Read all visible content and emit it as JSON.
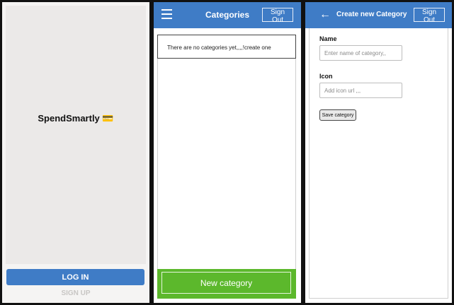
{
  "login": {
    "brand": "SpendSmartly",
    "brand_icon": "💳",
    "login_label": "LOG IN",
    "signup_label": "SIGN UP"
  },
  "categories": {
    "title": "Categories",
    "signout_label": "Sign Out",
    "empty_message": "There are no categories yet,,,,!create one",
    "new_category_label": "New category"
  },
  "create_category": {
    "back_glyph": "←",
    "title": "Create new Category",
    "signout_label": "Sign Out",
    "name_label": "Name",
    "name_placeholder": "Enter name of category,,",
    "icon_label": "Icon",
    "icon_placeholder": "Add icon url ,,,",
    "save_label": "Save category"
  },
  "colors": {
    "header_blue": "#3f7cc6",
    "footer_green": "#5cb82c"
  },
  "icons": {
    "menu": "hamburger-menu-icon",
    "back": "back-arrow-icon",
    "card": "credit-card-icon"
  }
}
